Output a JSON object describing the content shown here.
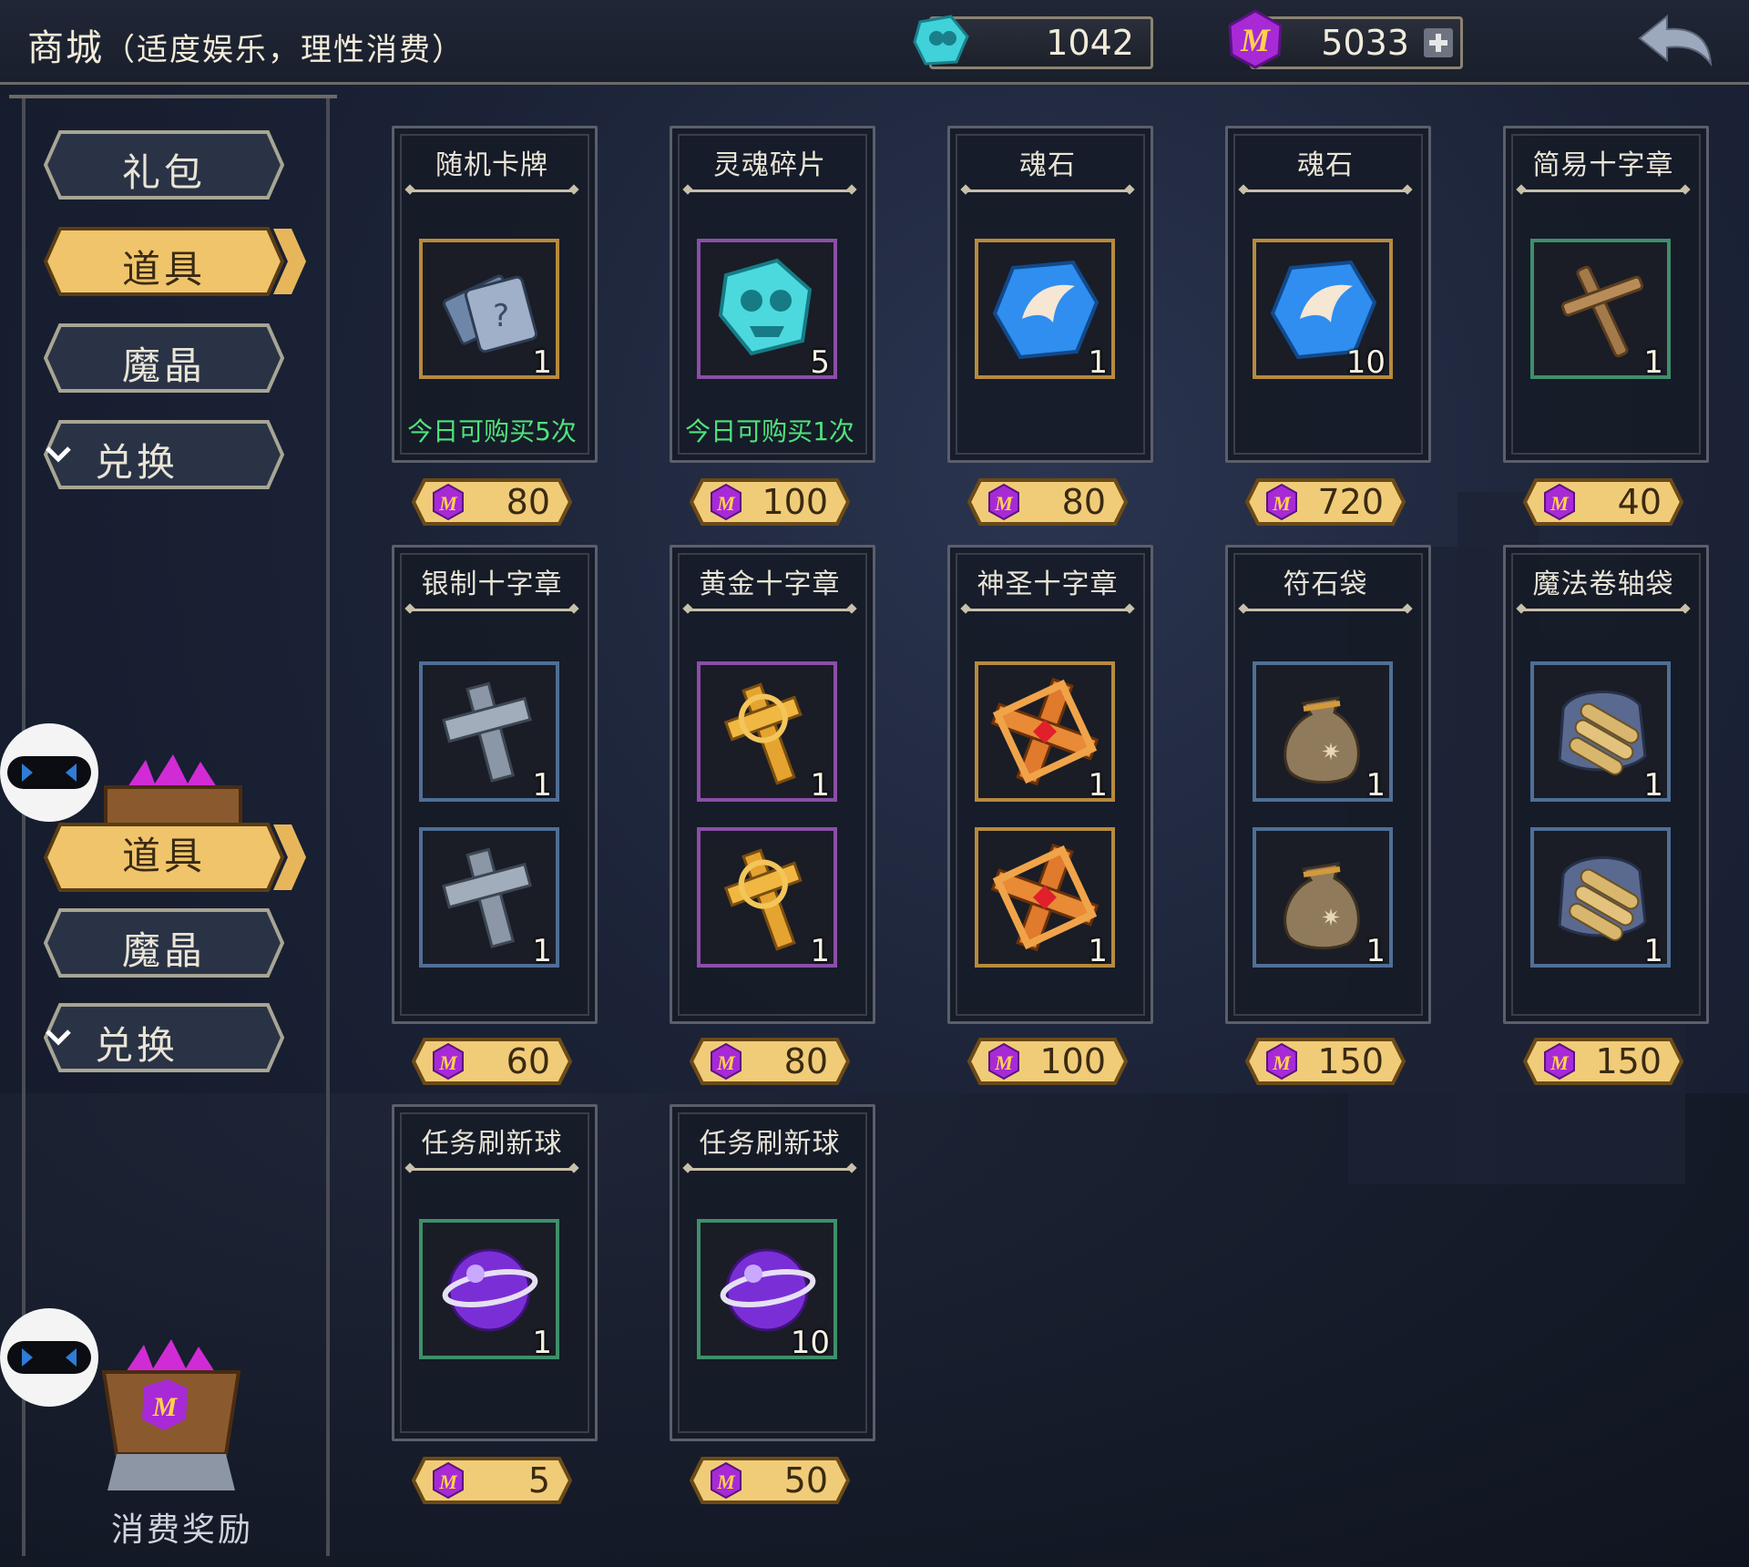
{
  "header": {
    "title": "商城",
    "subtitle": "（适度娱乐，理性消费）",
    "currency_soul": "1042",
    "currency_magic": "5033"
  },
  "sidebar": {
    "items": [
      {
        "label": "礼包",
        "active": false
      },
      {
        "label": "道具",
        "active": true
      },
      {
        "label": "魔晶",
        "active": false
      },
      {
        "label": "兑换",
        "active": false
      }
    ],
    "items_repeat": [
      {
        "label": "道具"
      },
      {
        "label": "魔晶"
      },
      {
        "label": "兑换"
      }
    ],
    "reward_label": "消费奖励"
  },
  "colors": {
    "accent_gold": "#e8b65a",
    "limit_green": "#4fe27a",
    "frame_gold": "#b78a3d",
    "frame_purple": "#8a4fa8",
    "frame_green": "#3f8f6b",
    "frame_blue": "#4f6f96"
  },
  "shop": {
    "items": [
      {
        "name": "随机卡牌",
        "qty": "1",
        "limit": "今日可购买5次",
        "price": "80",
        "frame": "gold",
        "icon": "card-pack-icon"
      },
      {
        "name": "灵魂碎片",
        "qty": "5",
        "limit": "今日可购买1次",
        "price": "100",
        "frame": "purple",
        "icon": "soul-shard-icon"
      },
      {
        "name": "魂石",
        "qty": "1",
        "price": "80",
        "frame": "gold",
        "icon": "soul-stone-icon"
      },
      {
        "name": "魂石",
        "qty": "10",
        "price": "720",
        "frame": "gold",
        "icon": "soul-stone-icon"
      },
      {
        "name": "简易十字章",
        "qty": "1",
        "price": "40",
        "frame": "green",
        "icon": "wooden-cross-icon"
      },
      {
        "name": "银制十字章",
        "qty": "1",
        "qty2": "1",
        "price": "60",
        "frame": "blue",
        "icon": "silver-cross-icon"
      },
      {
        "name": "黄金十字章",
        "qty": "1",
        "qty2": "1",
        "price": "80",
        "frame": "purple",
        "icon": "gold-cross-icon"
      },
      {
        "name": "神圣十字章",
        "qty": "1",
        "qty2": "1",
        "price": "100",
        "frame": "gold",
        "icon": "holy-cross-icon"
      },
      {
        "name": "符石袋",
        "qty": "1",
        "qty2": "1",
        "price": "150",
        "frame": "blue",
        "icon": "rune-bag-icon"
      },
      {
        "name": "魔法卷轴袋",
        "qty": "1",
        "qty2": "1",
        "price": "150",
        "frame": "blue",
        "icon": "scroll-bag-icon"
      },
      {
        "name": "任务刷新球",
        "qty": "1",
        "price": "5",
        "frame": "green",
        "icon": "refresh-orb-icon"
      },
      {
        "name": "任务刷新球",
        "qty": "10",
        "price": "50",
        "frame": "green",
        "icon": "refresh-orb-icon"
      }
    ]
  }
}
